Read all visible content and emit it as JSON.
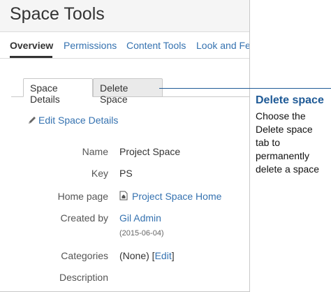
{
  "app": {
    "title": "Space Tools"
  },
  "nav": {
    "items": [
      {
        "label": "Overview"
      },
      {
        "label": "Permissions"
      },
      {
        "label": "Content Tools"
      },
      {
        "label": "Look and Fee"
      }
    ],
    "active_index": 0
  },
  "tabs": [
    {
      "label": "Space Details",
      "active": true
    },
    {
      "label": "Delete Space",
      "active": false
    }
  ],
  "edit_link": {
    "label": "Edit Space Details",
    "icon": "pencil-icon"
  },
  "details": {
    "name": {
      "label": "Name",
      "value": "Project Space"
    },
    "key": {
      "label": "Key",
      "value": "PS"
    },
    "home_page": {
      "label": "Home page",
      "value": "Project Space Home",
      "icon": "page-home-icon"
    },
    "created_by": {
      "label": "Created by",
      "value": "Gil Admin",
      "date": "(2015-06-04)"
    },
    "categories": {
      "label": "Categories",
      "value_prefix": "(None) [",
      "link": "Edit",
      "value_suffix": "]"
    },
    "description": {
      "label": "Description"
    }
  },
  "callout": {
    "heading": "Delete space",
    "lines": [
      "Choose the",
      "Delete space",
      "tab to",
      "permanently",
      "delete a space"
    ],
    "color": "#1f5a96"
  },
  "colors": {
    "link": "#3572b0",
    "header_bg": "#f5f5f5"
  }
}
